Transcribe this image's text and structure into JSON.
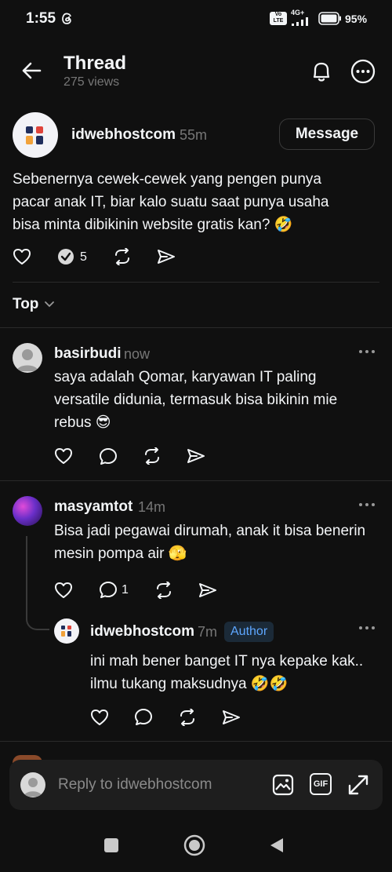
{
  "status_bar": {
    "time": "1:55",
    "network_badge": "4G+",
    "volte_badge": "Vo LTE",
    "battery": "95%"
  },
  "header": {
    "title": "Thread",
    "views": "275 views"
  },
  "post": {
    "author": "idwebhostcom",
    "time": "55m",
    "message_button": "Message",
    "text": "Sebenernya cewek-cewek yang pengen punya pacar anak IT, biar kalo suatu saat punya usaha bisa minta dibikinin website gratis kan? 🤣",
    "reply_count": "5"
  },
  "sort": {
    "label": "Top"
  },
  "comments": [
    {
      "author": "basirbudi",
      "time": "now",
      "text": "saya adalah Qomar, karyawan IT paling versatile didunia, termasuk bisa bikinin mie rebus 😎"
    },
    {
      "author": "masyamtot",
      "time": "14m",
      "text": "Bisa jadi pegawai dirumah, anak it bisa benerin mesin pompa air 🫣",
      "reply_count": "1"
    },
    {
      "author": "idwebhostcom",
      "time": "7m",
      "badge": "Author",
      "text": "ini mah bener banget IT nya kepake kak.. ilmu tukang maksudnya 🤣🤣"
    }
  ],
  "composer": {
    "placeholder": "Reply to idwebhostcom",
    "gif_label": "GIF"
  },
  "colors": {
    "background": "#101010",
    "text": "#f3f5f7",
    "muted": "#777777",
    "author_badge_bg": "#1b2a38",
    "author_badge_text": "#5ea7ff",
    "brand_dark": "#1f2d5c",
    "brand_orange": "#f2a23a",
    "brand_red": "#e0443b"
  }
}
